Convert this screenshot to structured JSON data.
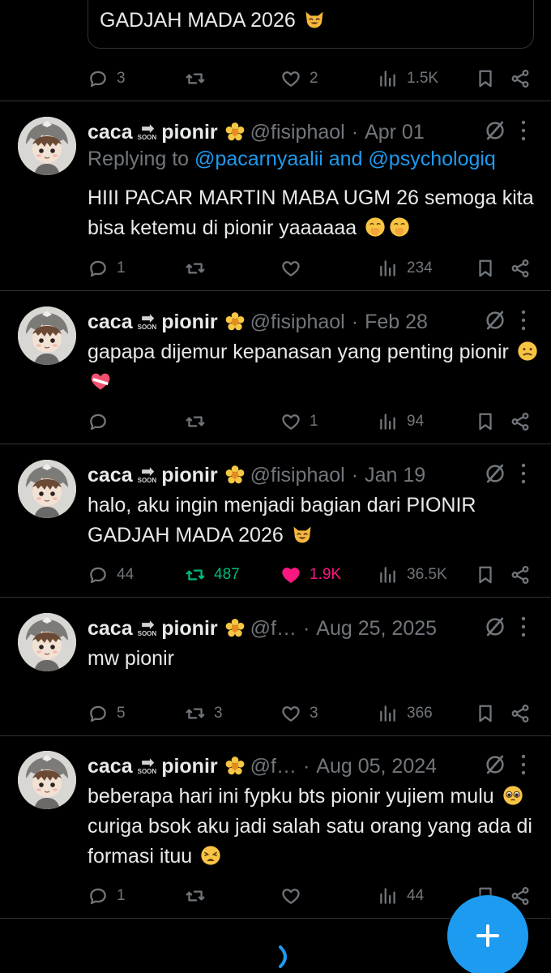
{
  "quoted": {
    "text": "GADJAH MADA 2026"
  },
  "top_actions": {
    "reply": "3",
    "retweet": "",
    "like": "2",
    "views": "1.5K"
  },
  "tweets": [
    {
      "name_left": "caca",
      "soon": "SOON",
      "name_right": "pionir",
      "handle": "@fisiphaol",
      "date": "Apr 01",
      "replying_prefix": "Replying to ",
      "replying_users": "@pacarnyaalii and @psychologiq",
      "text": "HIII PACAR MARTIN MABA UGM 26 semoga kita bisa ketemu di pionir yaaaaaa",
      "reply": "1",
      "retweet": "",
      "like": "",
      "views": "234"
    },
    {
      "name_left": "caca",
      "soon": "SOON",
      "name_right": "pionir",
      "handle": "@fisiphaol",
      "date": "Feb 28",
      "text": "gapapa dijemur kepanasan yang penting pionir",
      "reply": "",
      "retweet": "",
      "like": "1",
      "views": "94"
    },
    {
      "name_left": "caca",
      "soon": "SOON",
      "name_right": "pionir",
      "handle": "@fisiphaol",
      "date": "Jan 19",
      "text": "halo, aku ingin menjadi bagian dari PIONIR GADJAH MADA 2026",
      "reply": "44",
      "retweet": "487",
      "like": "1.9K",
      "views": "36.5K"
    },
    {
      "name_left": "caca",
      "soon": "SOON",
      "name_right": "pionir",
      "handle": "@f…",
      "date": "Aug 25, 2025",
      "text": "mw pionir",
      "reply": "5",
      "retweet": "3",
      "like": "3",
      "views": "366"
    },
    {
      "name_left": "caca",
      "soon": "SOON",
      "name_right": "pionir",
      "handle": "@f…",
      "date": "Aug 05, 2024",
      "text_a": "beberapa hari ini fypku bts pionir yujiem mulu",
      "text_b": "curiga bsok aku jadi salah satu orang yang ada di formasi ituu",
      "reply": "1",
      "retweet": "",
      "like": "",
      "views": "44"
    }
  ],
  "colors": {
    "accent": "#1d9bf0",
    "retweet_active": "#00ba7c",
    "like_active": "#f91880",
    "muted": "#71767b"
  },
  "icons": [
    "reply-icon",
    "retweet-icon",
    "like-icon",
    "views-icon",
    "bookmark-icon",
    "share-icon",
    "compose-icon",
    "grok-icon",
    "more-icon"
  ]
}
